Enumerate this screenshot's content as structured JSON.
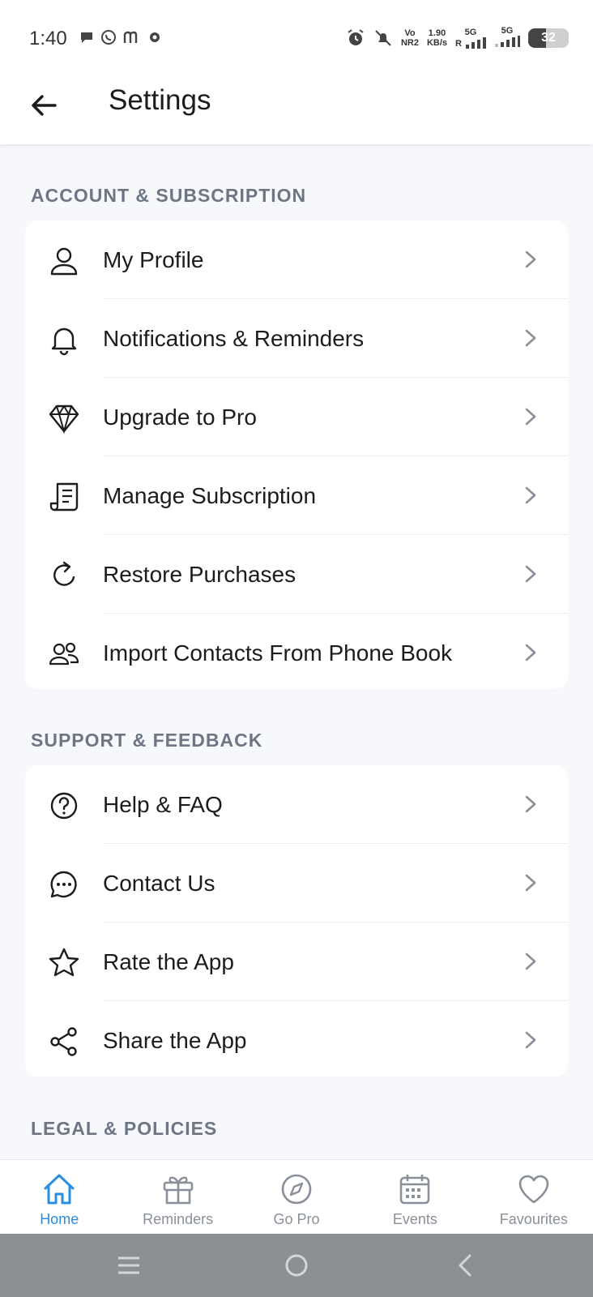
{
  "status_bar": {
    "time": "1:40",
    "net_type_top": "Vo",
    "net_type_bottom": "NR2",
    "speed_value": "1.90",
    "speed_unit": "KB/s",
    "sim1_label": "5G",
    "sim1_sub": "R",
    "sim2_label": "5G",
    "battery_level": "32"
  },
  "header": {
    "title": "Settings"
  },
  "sections": {
    "account": {
      "label": "ACCOUNT & SUBSCRIPTION",
      "items": [
        {
          "label": "My Profile",
          "icon": "user-icon"
        },
        {
          "label": "Notifications & Reminders",
          "icon": "bell-icon"
        },
        {
          "label": "Upgrade to Pro",
          "icon": "diamond-icon"
        },
        {
          "label": "Manage Subscription",
          "icon": "receipt-icon"
        },
        {
          "label": "Restore Purchases",
          "icon": "refresh-icon"
        },
        {
          "label": "Import Contacts From Phone Book",
          "icon": "contacts-icon"
        }
      ]
    },
    "support": {
      "label": "SUPPORT & FEEDBACK",
      "items": [
        {
          "label": "Help & FAQ",
          "icon": "help-icon"
        },
        {
          "label": "Contact Us",
          "icon": "chat-icon"
        },
        {
          "label": "Rate the App",
          "icon": "star-icon"
        },
        {
          "label": "Share the App",
          "icon": "share-icon"
        }
      ]
    },
    "legal": {
      "label": "LEGAL & POLICIES"
    }
  },
  "bottom_nav": {
    "items": [
      {
        "label": "Home",
        "icon": "home-icon",
        "active": true
      },
      {
        "label": "Reminders",
        "icon": "gift-icon"
      },
      {
        "label": "Go Pro",
        "icon": "compass-icon"
      },
      {
        "label": "Events",
        "icon": "calendar-icon"
      },
      {
        "label": "Favourites",
        "icon": "heart-icon"
      }
    ]
  },
  "colors": {
    "accent": "#2a8ee0",
    "background": "#f6f8fb",
    "section_label": "#6d7684",
    "text": "#1c1c1c"
  }
}
